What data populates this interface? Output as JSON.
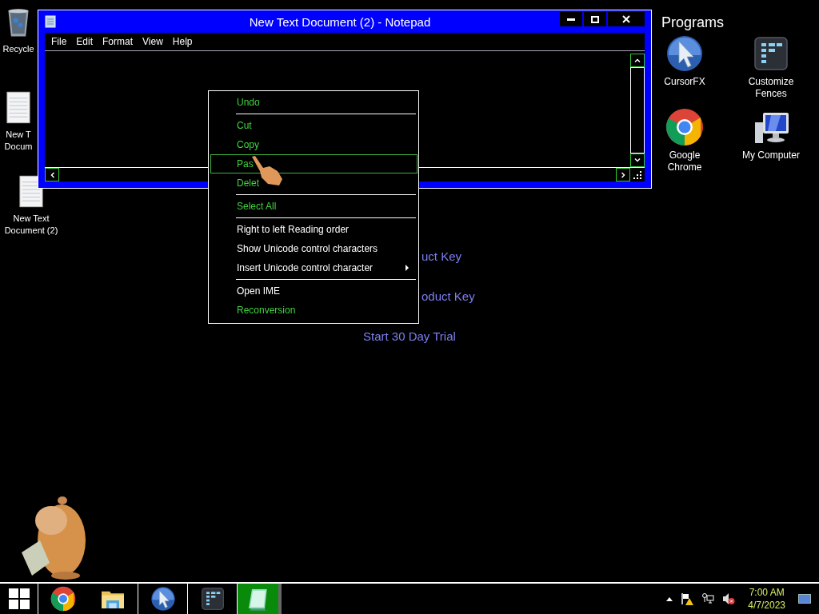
{
  "desktop_icons": [
    {
      "kind": "recycle-bin",
      "lines": [
        "Recycle"
      ]
    },
    {
      "kind": "text-file",
      "lines": [
        "New T",
        "Docum"
      ]
    },
    {
      "kind": "text-file",
      "lines": [
        "New Text",
        "Document (2)"
      ]
    }
  ],
  "background_links": [
    "uct Key",
    "oduct Key",
    "Start 30 Day Trial"
  ],
  "notepad": {
    "title": "New Text Document (2) - Notepad",
    "menu": [
      "File",
      "Edit",
      "Format",
      "View",
      "Help"
    ]
  },
  "context_menu": [
    {
      "kind": "item",
      "label": "Undo",
      "disabled": true,
      "selected": false,
      "submenu": false
    },
    {
      "kind": "separator"
    },
    {
      "kind": "item",
      "label": "Cut",
      "disabled": true,
      "selected": false,
      "submenu": false
    },
    {
      "kind": "item",
      "label": "Copy",
      "disabled": true,
      "selected": false,
      "submenu": false
    },
    {
      "kind": "item",
      "label": "Pas",
      "disabled": true,
      "selected": true,
      "submenu": false
    },
    {
      "kind": "item",
      "label": "Delet",
      "disabled": true,
      "selected": false,
      "submenu": false
    },
    {
      "kind": "separator"
    },
    {
      "kind": "item",
      "label": "Select All",
      "disabled": true,
      "selected": false,
      "submenu": false
    },
    {
      "kind": "separator"
    },
    {
      "kind": "item",
      "label": "Right to left Reading order",
      "disabled": false,
      "selected": false,
      "submenu": false
    },
    {
      "kind": "item",
      "label": "Show Unicode control characters",
      "disabled": false,
      "selected": false,
      "submenu": false
    },
    {
      "kind": "item",
      "label": "Insert Unicode control character",
      "disabled": false,
      "selected": false,
      "submenu": true
    },
    {
      "kind": "separator"
    },
    {
      "kind": "item",
      "label": "Open IME",
      "disabled": false,
      "selected": false,
      "submenu": false
    },
    {
      "kind": "item",
      "label": "Reconversion",
      "disabled": true,
      "selected": false,
      "submenu": false
    }
  ],
  "fence": {
    "title": "Programs",
    "items": [
      {
        "kind": "cursor",
        "lines": [
          "CursorFX"
        ]
      },
      {
        "kind": "fences",
        "lines": [
          "Customize",
          "Fences"
        ]
      },
      {
        "kind": "chrome",
        "lines": [
          "Google",
          "Chrome"
        ]
      },
      {
        "kind": "computer",
        "lines": [
          "My Computer"
        ]
      }
    ]
  },
  "taskbar": {
    "apps": [
      {
        "kind": "chrome",
        "active": false
      },
      {
        "kind": "explorer",
        "active": false
      },
      {
        "kind": "cursor",
        "active": false
      },
      {
        "kind": "fences",
        "active": false
      },
      {
        "kind": "notepad",
        "active": true
      }
    ],
    "time": "7:00 AM",
    "date": "4/7/2023"
  }
}
